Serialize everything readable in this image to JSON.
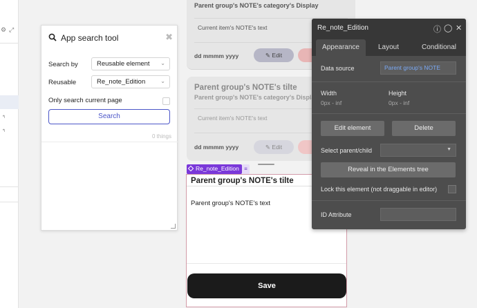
{
  "search_tool": {
    "title": "App search tool",
    "search_by_label": "Search by",
    "search_by_value": "Reusable element",
    "reusable_label": "Reusable",
    "reusable_value": "Re_note_Edition",
    "only_current_page_label": "Only search current page",
    "search_button": "Search",
    "result_count": "0 things"
  },
  "cards": [
    {
      "title": "",
      "subtitle": "Parent group's NOTE's category's Display",
      "text": "Current item's NOTE's text",
      "date": "dd mmmm yyyy",
      "edit_label": "Edit"
    },
    {
      "title": "Parent group's NOTE's tilte",
      "subtitle": "Parent group's NOTE's category's Display",
      "text": "Current item's NOTE's text",
      "date": "dd mmmm yyyy",
      "edit_label": "Edit"
    }
  ],
  "reusable_element": {
    "tag_label": "Re_note_Edition",
    "title": "Parent group's NOTE's tilte",
    "text": "Parent group's NOTE's text",
    "save_label": "Save"
  },
  "property_editor": {
    "title": "Re_note_Edition",
    "tabs": [
      "Appearance",
      "Layout",
      "Conditional"
    ],
    "active_tab": "Appearance",
    "data_source_label": "Data source",
    "data_source_value": "Parent group's NOTE",
    "width_label": "Width",
    "width_value": "0px - inf",
    "height_label": "Height",
    "height_value": "0px - inf",
    "edit_element_button": "Edit element",
    "delete_button": "Delete",
    "select_parent_label": "Select parent/child",
    "reveal_button": "Reveal in the Elements tree",
    "lock_label": "Lock this element (not draggable in editor)",
    "id_attribute_label": "ID Attribute"
  },
  "colors": {
    "accent": "#4a55c8",
    "reusable_tag": "#7a38d9",
    "panel_bg": "#4d4d4d",
    "data_source_link": "#7aa9f5"
  }
}
